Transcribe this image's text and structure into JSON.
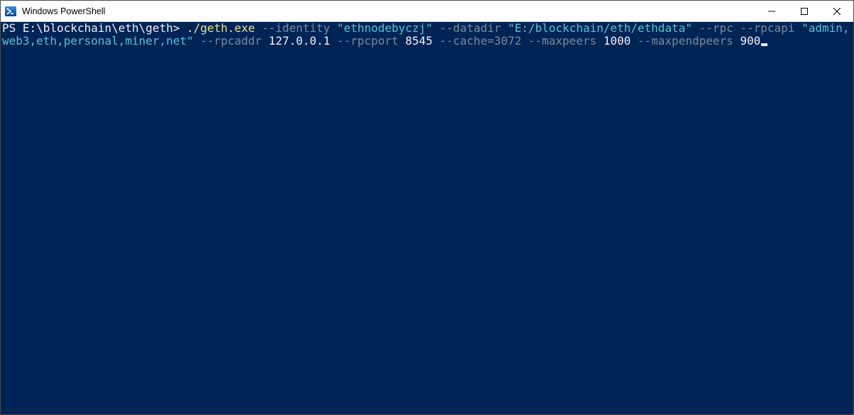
{
  "window": {
    "title": "Windows PowerShell"
  },
  "terminal": {
    "prompt_prefix": "PS ",
    "prompt_path": "E:\\blockchain\\eth\\geth",
    "prompt_suffix": "> ",
    "cmd_exe": "./geth.exe ",
    "flag_identity": "--identity ",
    "val_identity": "\"ethnodebyczj\" ",
    "flag_datadir": "--datadir ",
    "val_datadir": "\"E:/blockchain/eth/ethdata\" ",
    "flag_rpc": "--rpc ",
    "flag_rpcapi": "--rpcapi ",
    "val_rpcapi": "\"admin,web3,eth,personal,miner,net\" ",
    "flag_rpcaddr": "--rpcaddr ",
    "val_rpcaddr": "127.0.0.1 ",
    "flag_rpcport": "--rpcport ",
    "val_rpcport": "8545 ",
    "flag_cache": "--cache=3072 ",
    "flag_maxpeers": "--maxpeers ",
    "val_maxpeers": "1000 ",
    "flag_maxpendpeers": "--maxpendpeers ",
    "val_maxpendpeers": "900"
  }
}
